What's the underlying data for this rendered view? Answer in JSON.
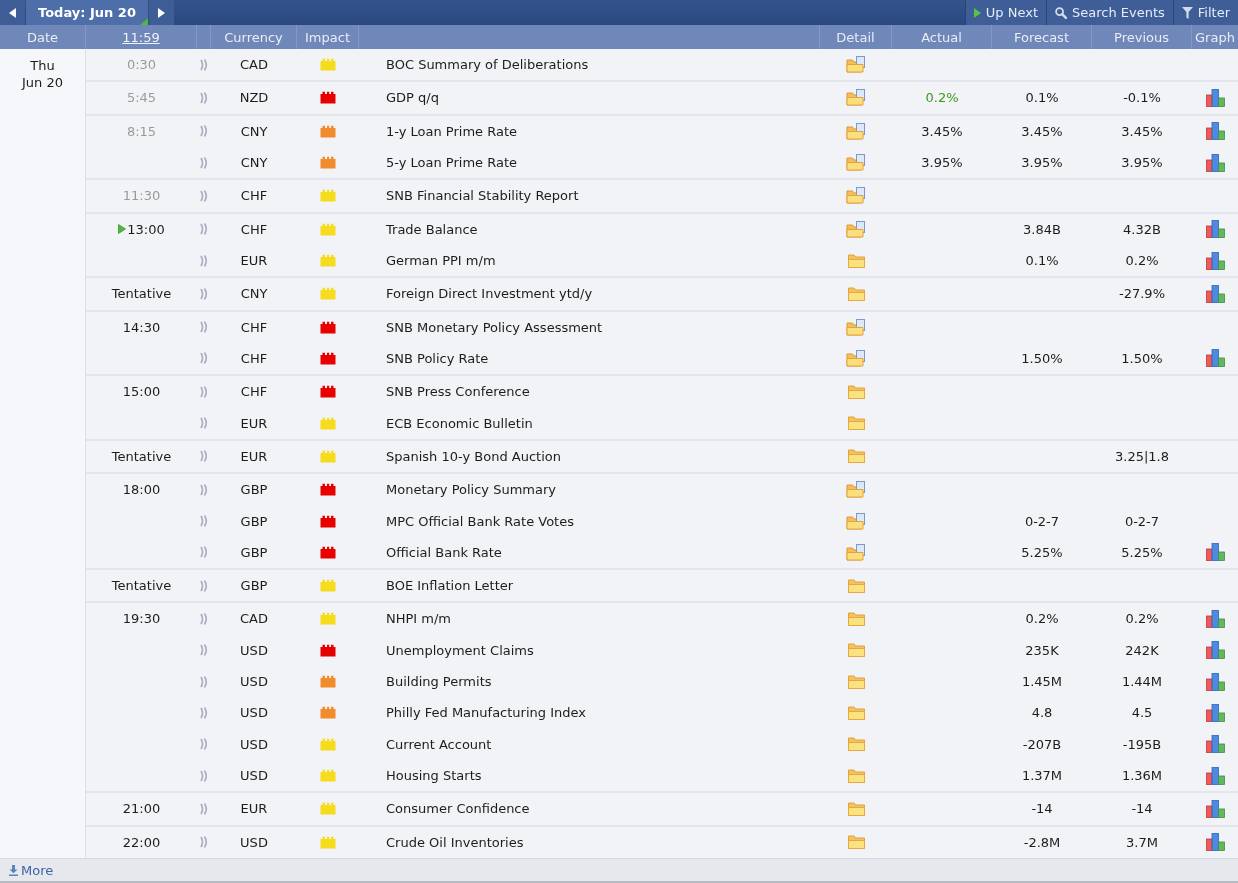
{
  "toolbar": {
    "date_tab": "Today: Jun 20",
    "actions": [
      {
        "kind": "up_next",
        "label": "Up Next"
      },
      {
        "kind": "search",
        "label": "Search Events"
      },
      {
        "kind": "filter",
        "label": "Filter"
      }
    ]
  },
  "columns": [
    {
      "kind": "date",
      "label": "Date"
    },
    {
      "kind": "clock",
      "label": "11:59"
    },
    {
      "kind": "currency",
      "label": "Currency"
    },
    {
      "kind": "impact",
      "label": "Impact"
    },
    {
      "kind": "detail",
      "label": "Detail"
    },
    {
      "kind": "actual",
      "label": "Actual"
    },
    {
      "kind": "forecast",
      "label": "Forecast"
    },
    {
      "kind": "previous",
      "label": "Previous"
    },
    {
      "kind": "graph",
      "label": "Graph"
    }
  ],
  "day": {
    "weekday": "Thu",
    "date": "Jun 20"
  },
  "events": [
    {
      "time": "0:30",
      "past": true,
      "next": false,
      "currency": "CAD",
      "color": "#f5dc1c",
      "event": "BOC Summary of Deliberations",
      "has_page": true,
      "graph": false
    },
    {
      "time": "5:45",
      "past": true,
      "next": false,
      "currency": "NZD",
      "color": "#e60000",
      "event": "GDP q/q",
      "has_page": true,
      "actual": "0.2%",
      "better": true,
      "forecast": "0.1%",
      "previous": "-0.1%",
      "graph": true
    },
    {
      "time": "8:15",
      "past": true,
      "next": false,
      "currency": "CNY",
      "color": "#f08c2c",
      "event": "1-y Loan Prime Rate",
      "has_page": true,
      "actual": "3.45%",
      "better": false,
      "forecast": "3.45%",
      "previous": "3.45%",
      "graph": true
    },
    {
      "currency": "CNY",
      "color": "#f08c2c",
      "event": "5-y Loan Prime Rate",
      "has_page": true,
      "actual": "3.95%",
      "better": false,
      "forecast": "3.95%",
      "previous": "3.95%",
      "graph": true
    },
    {
      "time": "11:30",
      "past": true,
      "next": false,
      "currency": "CHF",
      "color": "#f5dc1c",
      "event": "SNB Financial Stability Report",
      "has_page": true,
      "graph": false
    },
    {
      "time": "13:00",
      "past": false,
      "next": true,
      "currency": "CHF",
      "color": "#f5dc1c",
      "event": "Trade Balance",
      "has_page": true,
      "forecast": "3.84B",
      "previous": "4.32B",
      "graph": true
    },
    {
      "currency": "EUR",
      "color": "#f5dc1c",
      "event": "German PPI m/m",
      "has_page": false,
      "forecast": "0.1%",
      "previous": "0.2%",
      "graph": true
    },
    {
      "time": "Tentative",
      "past": false,
      "next": false,
      "currency": "CNY",
      "color": "#f5dc1c",
      "event": "Foreign Direct Investment ytd/y",
      "has_page": false,
      "previous": "-27.9%",
      "graph": true
    },
    {
      "time": "14:30",
      "past": false,
      "next": false,
      "currency": "CHF",
      "color": "#e60000",
      "event": "SNB Monetary Policy Assessment",
      "has_page": true,
      "graph": false
    },
    {
      "currency": "CHF",
      "color": "#e60000",
      "event": "SNB Policy Rate",
      "has_page": true,
      "forecast": "1.50%",
      "previous": "1.50%",
      "graph": true
    },
    {
      "time": "15:00",
      "past": false,
      "next": false,
      "currency": "CHF",
      "color": "#e60000",
      "event": "SNB Press Conference",
      "has_page": false,
      "graph": false
    },
    {
      "currency": "EUR",
      "color": "#f5dc1c",
      "event": "ECB Economic Bulletin",
      "has_page": false,
      "graph": false
    },
    {
      "time": "Tentative",
      "past": false,
      "next": false,
      "currency": "EUR",
      "color": "#f5dc1c",
      "event": "Spanish 10-y Bond Auction",
      "has_page": false,
      "previous": "3.25|1.8",
      "graph": false
    },
    {
      "time": "18:00",
      "past": false,
      "next": false,
      "currency": "GBP",
      "color": "#e60000",
      "event": "Monetary Policy Summary",
      "has_page": true,
      "graph": false
    },
    {
      "currency": "GBP",
      "color": "#e60000",
      "event": "MPC Official Bank Rate Votes",
      "has_page": true,
      "forecast": "0-2-7",
      "previous": "0-2-7",
      "graph": false
    },
    {
      "currency": "GBP",
      "color": "#e60000",
      "event": "Official Bank Rate",
      "has_page": true,
      "forecast": "5.25%",
      "previous": "5.25%",
      "graph": true
    },
    {
      "time": "Tentative",
      "past": false,
      "next": false,
      "currency": "GBP",
      "color": "#f5dc1c",
      "event": "BOE Inflation Letter",
      "has_page": false,
      "graph": false
    },
    {
      "time": "19:30",
      "past": false,
      "next": false,
      "currency": "CAD",
      "color": "#f5dc1c",
      "event": "NHPI m/m",
      "has_page": false,
      "forecast": "0.2%",
      "previous": "0.2%",
      "graph": true
    },
    {
      "currency": "USD",
      "color": "#e60000",
      "event": "Unemployment Claims",
      "has_page": false,
      "forecast": "235K",
      "previous": "242K",
      "graph": true
    },
    {
      "currency": "USD",
      "color": "#f08c2c",
      "event": "Building Permits",
      "has_page": false,
      "forecast": "1.45M",
      "previous": "1.44M",
      "graph": true
    },
    {
      "currency": "USD",
      "color": "#f08c2c",
      "event": "Philly Fed Manufacturing Index",
      "has_page": false,
      "forecast": "4.8",
      "previous": "4.5",
      "graph": true
    },
    {
      "currency": "USD",
      "color": "#f5dc1c",
      "event": "Current Account",
      "has_page": false,
      "forecast": "-207B",
      "previous": "-195B",
      "graph": true
    },
    {
      "currency": "USD",
      "color": "#f5dc1c",
      "event": "Housing Starts",
      "has_page": false,
      "forecast": "1.37M",
      "previous": "1.36M",
      "graph": true
    },
    {
      "time": "21:00",
      "past": false,
      "next": false,
      "currency": "EUR",
      "color": "#f5dc1c",
      "event": "Consumer Confidence",
      "has_page": false,
      "forecast": "-14",
      "previous": "-14",
      "graph": true
    },
    {
      "time": "22:00",
      "past": false,
      "next": false,
      "currency": "USD",
      "color": "#f5dc1c",
      "event": "Crude Oil Inventories",
      "has_page": false,
      "forecast": "-2.8M",
      "previous": "3.7M",
      "graph": true
    }
  ],
  "footer": {
    "more": "More"
  }
}
